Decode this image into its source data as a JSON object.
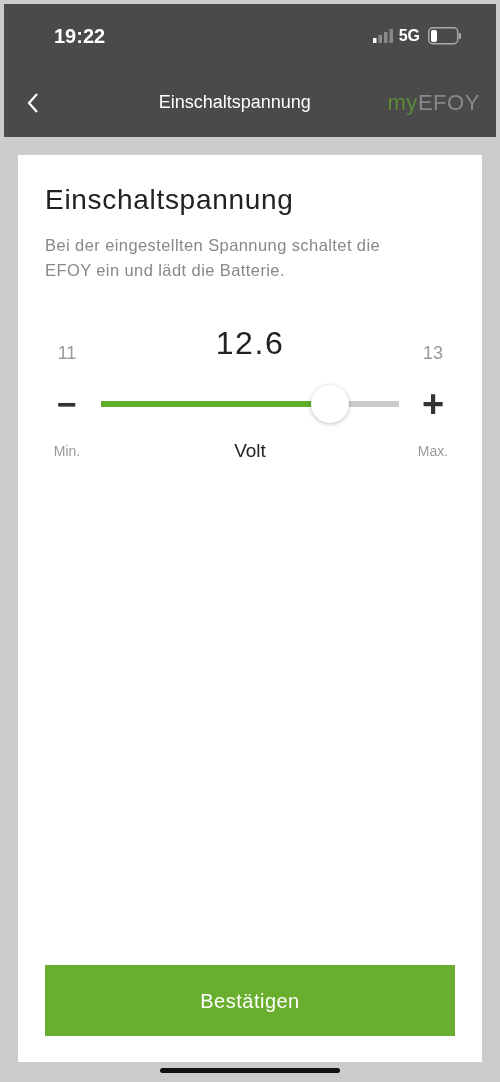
{
  "status_bar": {
    "time": "19:22",
    "network": "5G"
  },
  "nav": {
    "title": "Einschaltspannung",
    "logo": [
      "my",
      "EFOY"
    ]
  },
  "card": {
    "title": "Einschaltspannung",
    "description": "Bei der eingestellten Spannung schaltet die EFOY ein und lädt die Batterie."
  },
  "slider": {
    "min": "11",
    "max": "13",
    "value": "12.6",
    "level": 0.77,
    "decrease": "−",
    "increase": "+",
    "min_label": "Min.",
    "max_label": "Max.",
    "unit": "Volt"
  },
  "confirm_button": "Bestätigen"
}
